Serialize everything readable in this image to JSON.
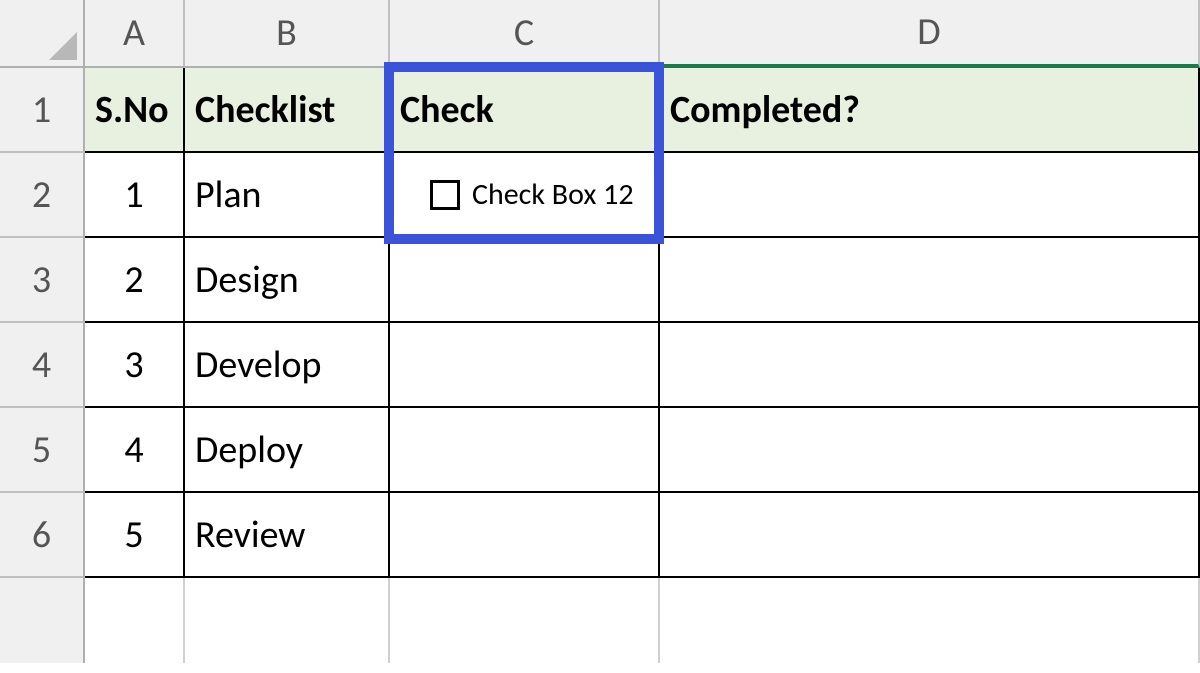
{
  "columns": [
    "A",
    "B",
    "C",
    "D"
  ],
  "rows": [
    "1",
    "2",
    "3",
    "4",
    "5",
    "6"
  ],
  "headers": {
    "a": "S.No",
    "b": "Checklist",
    "c": "Check",
    "d": "Completed?"
  },
  "data": [
    {
      "sno": "1",
      "checklist": "Plan"
    },
    {
      "sno": "2",
      "checklist": "Design"
    },
    {
      "sno": "3",
      "checklist": "Develop"
    },
    {
      "sno": "4",
      "checklist": "Deploy"
    },
    {
      "sno": "5",
      "checklist": "Review"
    }
  ],
  "checkbox": {
    "label": "Check Box 12",
    "checked": false
  }
}
